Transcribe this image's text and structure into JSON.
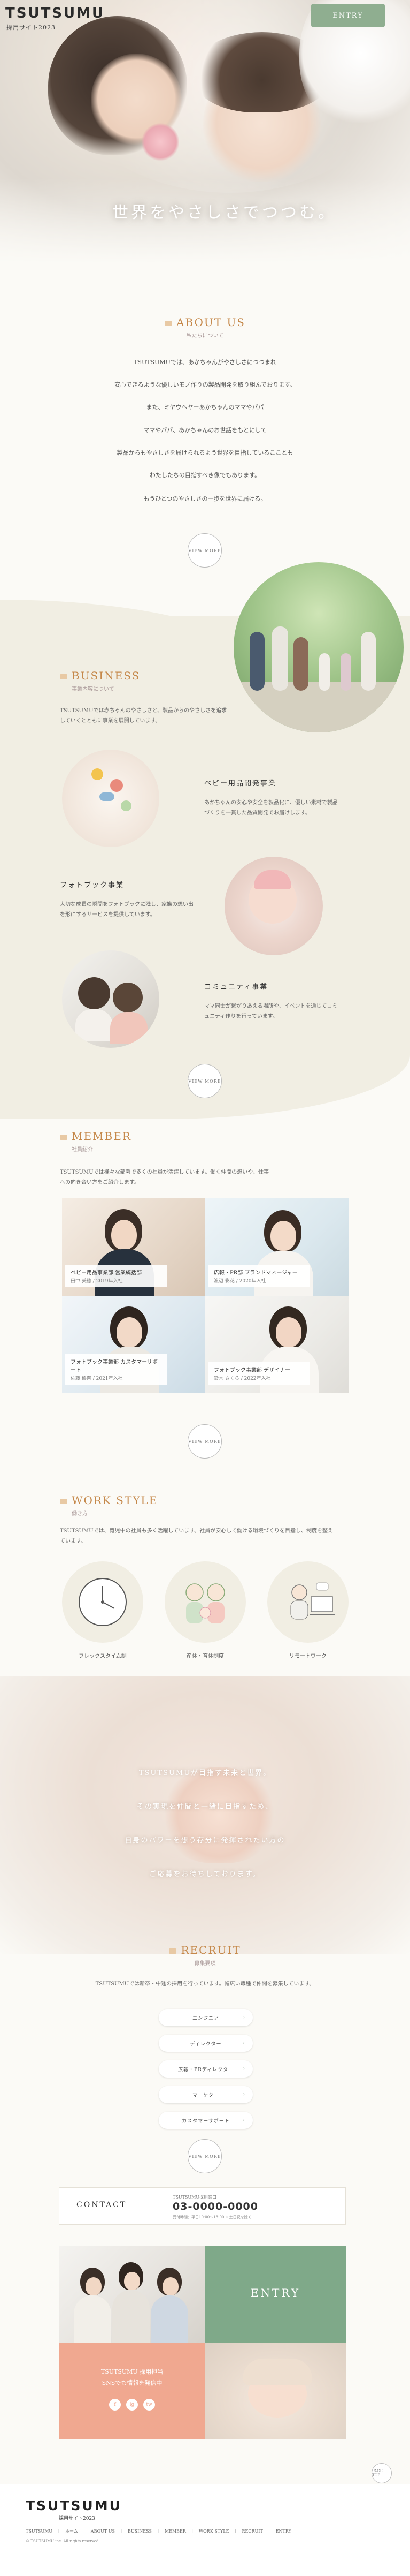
{
  "header": {
    "logo": "TSUTSUMU",
    "logo_sub": "採用サイト2023",
    "entry_label": "ENTRY"
  },
  "hero": {
    "copy": "世界をやさしさでつつむ。"
  },
  "about": {
    "title_en": "ABOUT US",
    "title_ja": "私たちについて",
    "paragraphs": [
      "TSUTSUMUでは、あかちゃんがやさしさにつつまれ",
      "安心できるような優しいモノ作りの製品開発を取り組んでおります。",
      "また、ミヤウヘヤーあかちゃんのママやパパ",
      "ママやパパ、あかちゃんのお世話をもとにして",
      "製品からもやさしさを届けられるよう世界を目指しているこことも",
      "わたしたちの目指すべき像でもあります。",
      "もうひとつのやさしさの一歩を世界に届ける。"
    ],
    "more_label": "VIEW MORE"
  },
  "business": {
    "title_en": "BUSINESS",
    "title_ja": "事業内容について",
    "intro": "TSUTSUMUでは赤ちゃんのやさしさと、製品からのやさしさを追求していくとともに事業を展開しています。",
    "items": [
      {
        "head": "ベビー用品開発事業",
        "text": "あかちゃんの安心や安全を製品化に、優しい素材で製品づくりを一貫した品質開発でお届けします。"
      },
      {
        "head": "フォトブック事業",
        "text": "大切な成長の瞬間をフォトブックに残し、家族の想い出を形にするサービスを提供しています。"
      },
      {
        "head": "コミュニティ事業",
        "text": "ママ同士が繋がりあえる場所や、イベントを通じてコミュニティ作りを行っています。"
      }
    ],
    "more_label": "VIEW MORE"
  },
  "member": {
    "title_en": "MEMBER",
    "title_ja": "社員紹介",
    "intro": "TSUTSUMUでは様々な部署で多くの社員が活躍しています。働く仲間の想いや、仕事への向き合い方をご紹介します。",
    "cards": [
      {
        "dept": "ベビー用品事業部 営業統括部",
        "name": "田中 美穂 / 2019年入社"
      },
      {
        "dept": "広報・PR部 ブランドマネージャー",
        "name": "渡辺 彩花 / 2020年入社"
      },
      {
        "dept": "フォトブック事業部 カスタマーサポート",
        "name": "佐藤 優奈 / 2021年入社"
      },
      {
        "dept": "フォトブック事業部 デザイナー",
        "name": "鈴木 さくら / 2022年入社"
      }
    ],
    "more_label": "VIEW MORE"
  },
  "work": {
    "title_en": "WORK STYLE",
    "title_ja": "働き方",
    "intro": "TSUTSUMUでは、育児中の社員も多く活躍しています。社員が安心して働ける環境づくりを目指し、制度を整えています。",
    "items": [
      {
        "label": "フレックスタイム制"
      },
      {
        "label": "産休・育休制度"
      },
      {
        "label": "リモートワーク"
      }
    ],
    "more_label": "VIEW MORE"
  },
  "message": {
    "lines": [
      "TSUTSUMUが目指す未来と世界。",
      "その実現を仲間と一緒に目指すため、",
      "自身のパワーを想う存分に発揮されたい方の",
      "ご応募をお待ちしております。"
    ]
  },
  "recruit": {
    "title_en": "RECRUIT",
    "title_ja": "募集要項",
    "intro": "TSUTSUMUでは新卒・中途の採用を行っています。幅広い職種で仲間を募集しています。",
    "buttons": [
      "エンジニア",
      "ディレクター",
      "広報・PRディレクター",
      "マーケター",
      "カスタマーサポート"
    ],
    "more_label": "VIEW MORE"
  },
  "contact": {
    "label": "CONTACT",
    "sub": "TSUTSUMU採用窓口",
    "phone": "03-0000-0000",
    "hours": "受付時間：平日10:00〜18:00 ※土日祝を除く"
  },
  "entry_block": {
    "label": "ENTRY",
    "pink_text_1": "TSUTSUMU 採用担当",
    "pink_text_2": "SNSでも情報を発信中",
    "sns": [
      "f",
      "ig",
      "tw"
    ]
  },
  "footer": {
    "logo": "TSUTSUMU",
    "sub": "採用サイト2023",
    "links": "TSUTSUMU　｜　ホーム　｜　ABOUT US　｜　BUSINESS　｜　MEMBER　｜　WORK STYLE　｜　RECRUIT　｜　ENTRY",
    "copyright": "© TSUTSUMU inc. All rights reserved.",
    "pagetop": "PAGE TOP"
  },
  "colors": {
    "accent": "#c5884a",
    "green": "#7fa989",
    "pink": "#f0a890",
    "beige": "#f1eee3"
  }
}
